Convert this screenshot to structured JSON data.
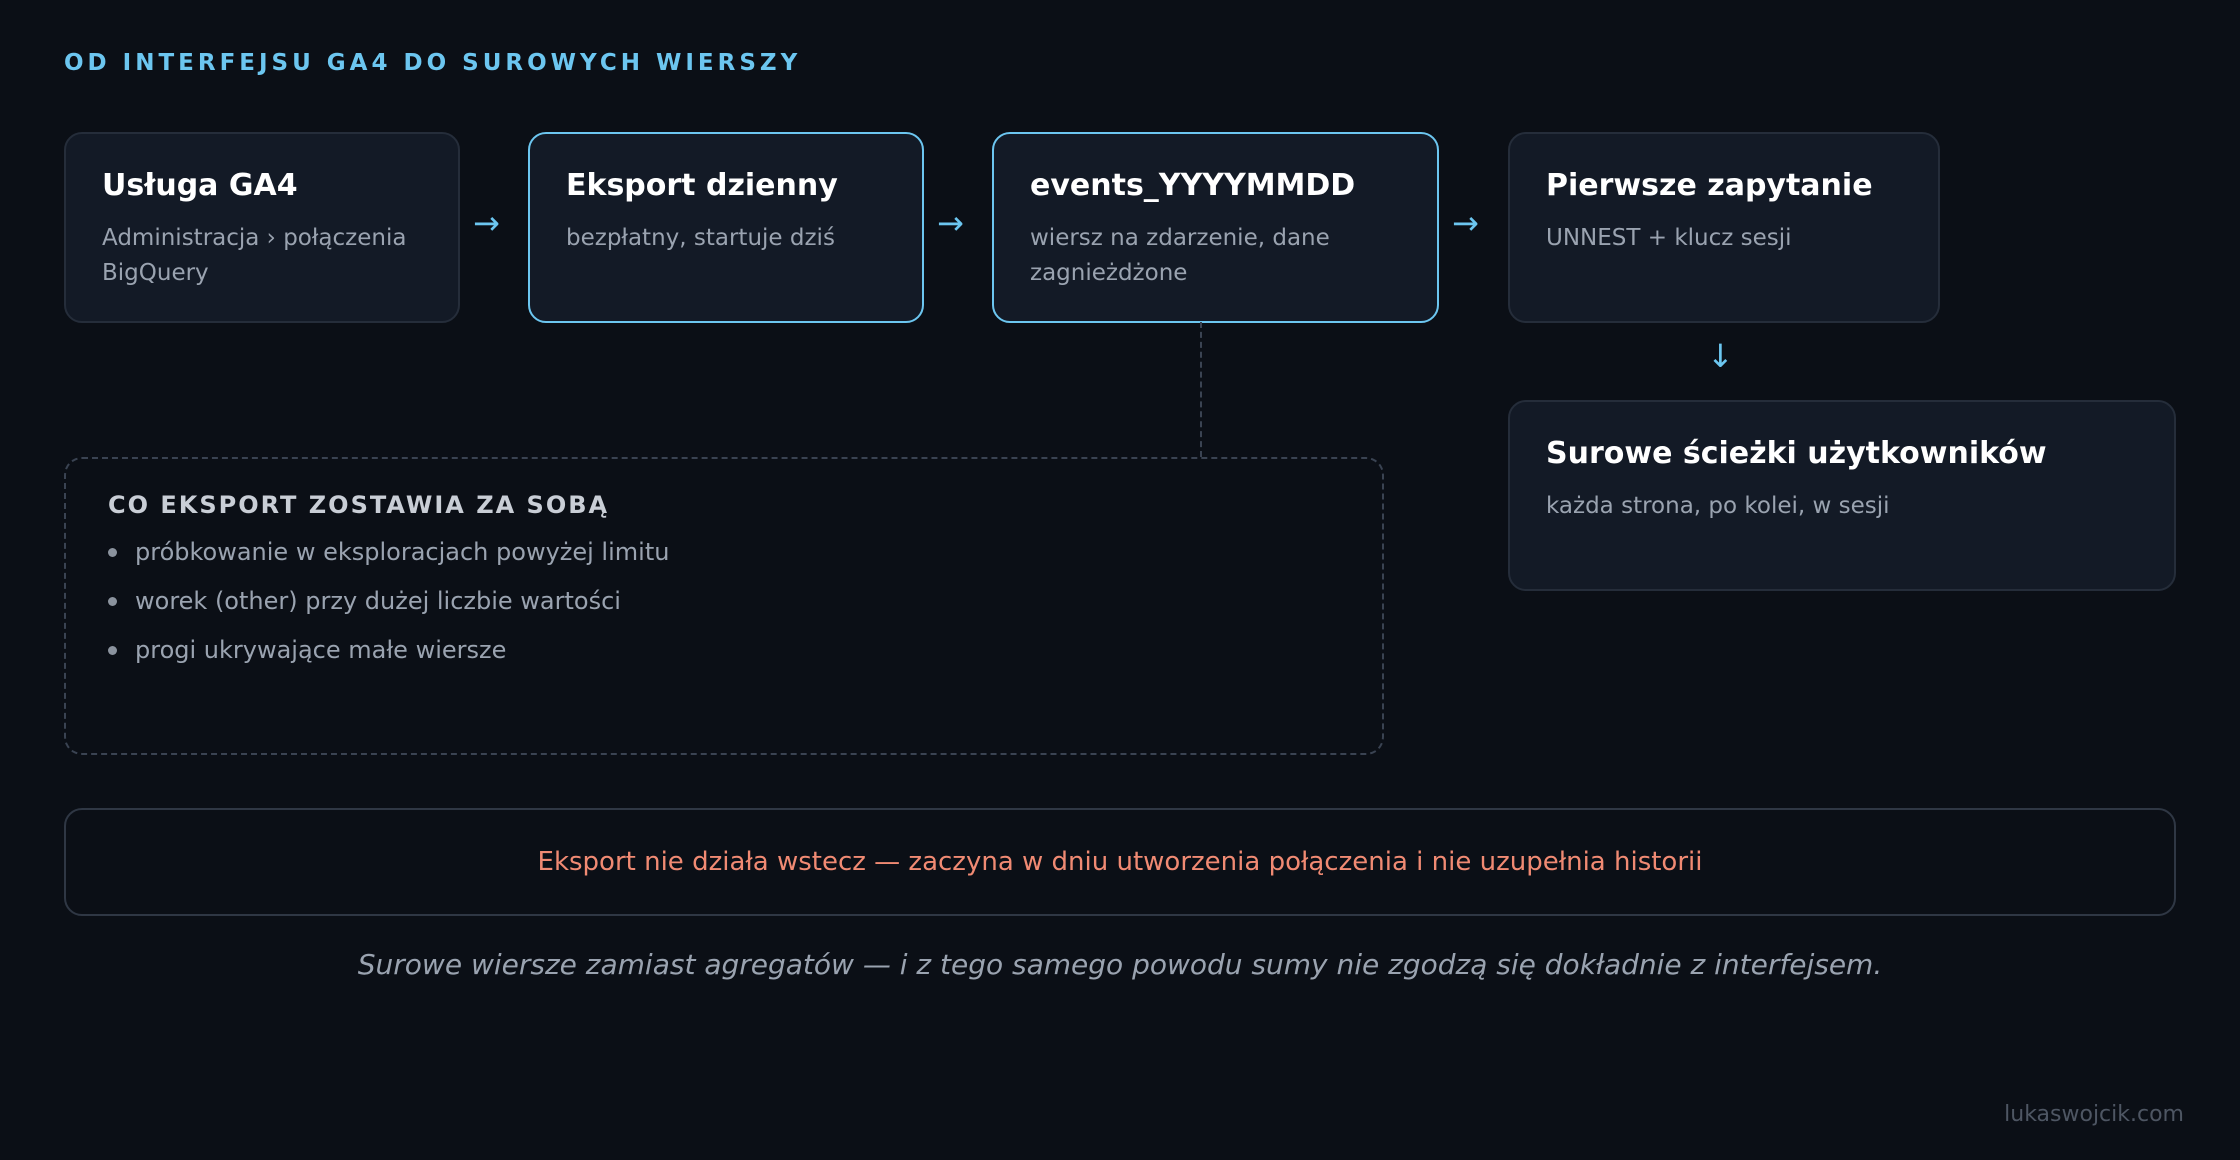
{
  "title": "OD INTERFEJSU GA4 DO SUROWYCH WIERSZY",
  "steps": [
    {
      "title": "Usługa GA4",
      "subtitle": "Administracja › połączenia BigQuery"
    },
    {
      "title": "Eksport dzienny",
      "subtitle": "bezpłatny, startuje dziś"
    },
    {
      "title": "events_YYYYMMDD",
      "subtitle": "wiersz na zdarzenie, dane zagnieżdżone"
    },
    {
      "title": "Pierwsze zapytanie",
      "subtitle": "UNNEST + klucz sesji"
    },
    {
      "title": "Surowe ścieżki użytkowników",
      "subtitle": "każda strona, po kolei, w sesji"
    }
  ],
  "arrow_right": "→",
  "arrow_down": "↓",
  "left_behind": {
    "title": "CO EKSPORT ZOSTAWIA ZA SOBĄ",
    "items": [
      "próbkowanie w eksploracjach powyżej limitu",
      "worek (other) przy dużej liczbie wartości",
      "progi ukrywające małe wiersze"
    ]
  },
  "warning": "Eksport nie działa wstecz — zaczyna w dniu utworzenia połączenia i nie uzupełnia historii",
  "caption": "Surowe wiersze zamiast agregatów — i z tego samego powodu sumy nie zgodzą się dokładnie z interfejsem.",
  "footer": "lukaswojcik.com",
  "colors": {
    "accent": "#6cc6f0",
    "warning": "#f08a73",
    "background": "#0b0f16"
  }
}
